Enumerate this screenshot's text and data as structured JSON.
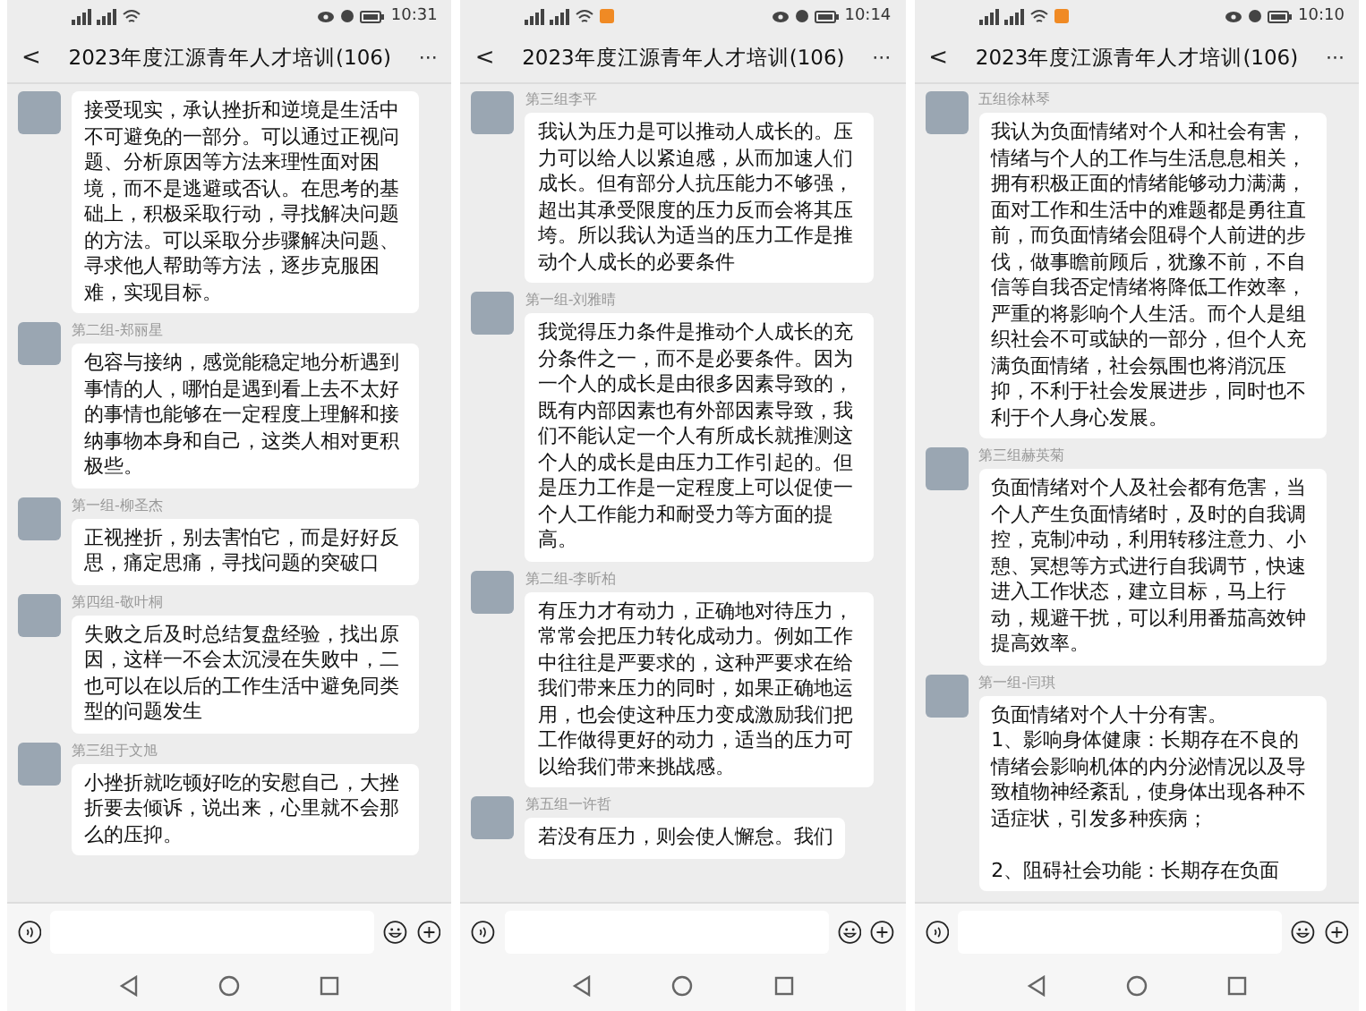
{
  "phones": [
    {
      "status_bar": {
        "time": "10:31",
        "notification": false
      },
      "header": {
        "back": "<",
        "title": "2023年度江源青年人才培训(106)",
        "more": "···"
      },
      "messages": [
        {
          "text": "接受现实，承认挫折和逆境是生活中不可避免的一部分。可以通过正视问题、分析原因等方法来理性面对困境，而不是逃避或否认。在思考的基础上，积极采取行动，寻找解决问题的方法。可以采取分步骤解决问题、寻求他人帮助等方法，逐步克服困难，实现目标。"
        },
        {
          "sender": "第二组-郑丽星",
          "text": "包容与接纳，感觉能稳定地分析遇到事情的人，哪怕是遇到看上去不太好的事情也能够在一定程度上理解和接纳事物本身和自己，这类人相对更积极些。"
        },
        {
          "sender": "第一组-柳圣杰",
          "text": "正视挫折，别去害怕它，而是好好反思，痛定思痛，寻找问题的突破口"
        },
        {
          "sender": "第四组-敬叶桐",
          "text": "失败之后及时总结复盘经验，找出原因，这样一不会太沉浸在失败中，二也可以在以后的工作生活中避免同类型的问题发生"
        },
        {
          "sender": "第三组于文旭",
          "text": "小挫折就吃顿好吃的安慰自己，大挫折要去倾诉，说出来，心里就不会那么的压抑。"
        }
      ]
    },
    {
      "status_bar": {
        "time": "10:14",
        "notification": true
      },
      "header": {
        "back": "<",
        "title": "2023年度江源青年人才培训(106)",
        "more": "···"
      },
      "messages": [
        {
          "sender": "第三组李平",
          "text": "我认为压力是可以推动人成长的。压力可以给人以紧迫感，从而加速人们成长。但有部分人抗压能力不够强，超出其承受限度的压力反而会将其压垮。所以我认为适当的压力工作是推动个人成长的必要条件"
        },
        {
          "sender": "第一组-刘雅晴",
          "text": "我觉得压力条件是推动个人成长的充分条件之一，而不是必要条件。因为一个人的成长是由很多因素导致的，既有内部因素也有外部因素导致，我们不能认定一个人有所成长就推测这个人的成长是由压力工作引起的。但是压力工作是一定程度上可以促使一个人工作能力和耐受力等方面的提高。"
        },
        {
          "sender": "第二组-李昕柏",
          "text": "有压力才有动力，正确地对待压力，常常会把压力转化成动力。例如工作中往往是严要求的，这种严要求在给我们带来压力的同时，如果正确地运用，也会使这种压力变成激励我们把工作做得更好的动力，适当的压力可以给我们带来挑战感。"
        },
        {
          "sender": "第五组一许哲",
          "text": "若没有压力，则会使人懈怠。我们"
        }
      ]
    },
    {
      "status_bar": {
        "time": "10:10",
        "notification": true
      },
      "header": {
        "back": "<",
        "title": "2023年度江源青年人才培训(106)",
        "more": "···"
      },
      "messages": [
        {
          "sender": "五组徐林琴",
          "text": "我认为负面情绪对个人和社会有害，情绪与个人的工作与生活息息相关，拥有积极正面的情绪能够动力满满，面对工作和生活中的难题都是勇往直前，而负面情绪会阻碍个人前进的步伐，做事瞻前顾后，犹豫不前，不自信等自我否定情绪将降低工作效率，严重的将影响个人生活。而个人是组织社会不可或缺的一部分，但个人充满负面情绪，社会氛围也将消沉压抑，不利于社会发展进步，同时也不利于个人身心发展。"
        },
        {
          "sender": "第三组赫英菊",
          "text": "负面情绪对个人及社会都有危害，当个人产生负面情绪时，及时的自我调控，克制冲动，利用转移注意力、小憩、冥想等方式进行自我调节，快速进入工作状态，建立目标，马上行动，规避干扰，可以利用番茄高效钟提高效率。"
        },
        {
          "sender": "第一组-闫琪",
          "text": "负面情绪对个人十分有害。\n1、影响身体健康：长期存在不良的情绪会影响机体的内分泌情况以及导致植物神经紊乱，使身体出现各种不适症状，引发多种疾病；\n\n2、阻碍社会功能：长期存在负面"
        }
      ]
    }
  ]
}
